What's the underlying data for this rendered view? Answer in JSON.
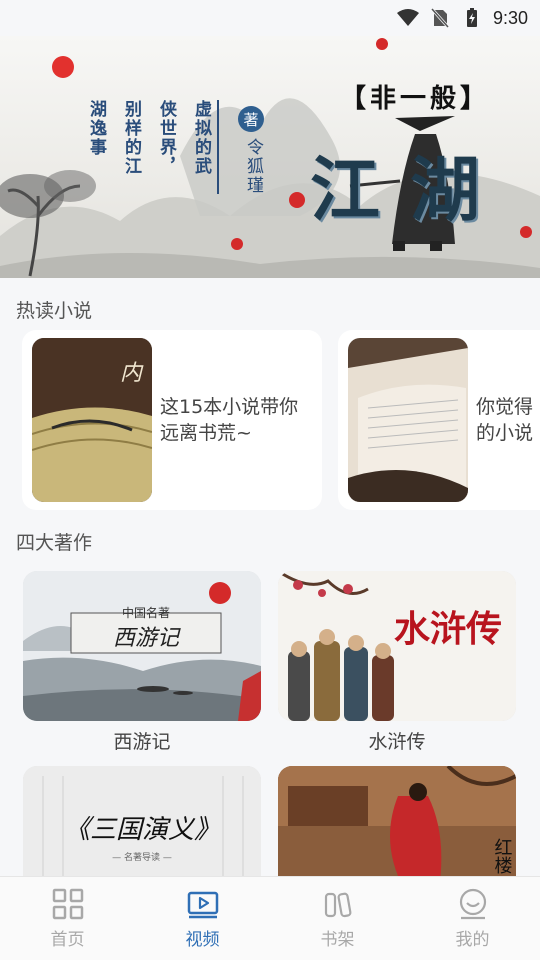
{
  "status_bar": {
    "time": "9:30"
  },
  "banner": {
    "subtitle": "【非一般】",
    "title": "江湖",
    "poem_columns": [
      "虚拟的武",
      "侠世界，",
      "别样的江",
      "湖逸事"
    ],
    "author_mark": "著",
    "author_name": "令狐瑾"
  },
  "hot_section": {
    "title": "热读小说",
    "items": [
      {
        "text_line1": "这15本小说带你",
        "text_line2": "远离书荒~"
      },
      {
        "text_line1": "你觉得",
        "text_line2": "的小说"
      }
    ]
  },
  "classics_section": {
    "title": "四大著作",
    "items": [
      {
        "label": "西游记",
        "cover_small": "中国名著",
        "cover_title": "西游记"
      },
      {
        "label": "水浒传",
        "cover_title": "水浒传"
      },
      {
        "label": "",
        "cover_title": "《三国演义》",
        "cover_small": "— 名著导读 —"
      },
      {
        "label": "",
        "cover_title": "红楼"
      }
    ]
  },
  "bottom_nav": {
    "items": [
      {
        "label": "首页",
        "icon": "grid-icon",
        "active": false
      },
      {
        "label": "视频",
        "icon": "video-icon",
        "active": true
      },
      {
        "label": "书架",
        "icon": "bookshelf-icon",
        "active": false
      },
      {
        "label": "我的",
        "icon": "profile-icon",
        "active": false
      }
    ]
  },
  "colors": {
    "accent": "#2f6fb5",
    "inactive": "#a8a8a8",
    "background": "#f6f7f9"
  }
}
